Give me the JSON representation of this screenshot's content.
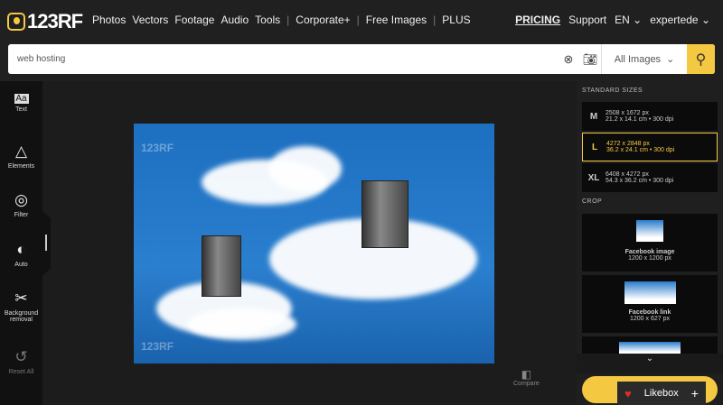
{
  "header": {
    "logo": "123RF",
    "nav": [
      "Photos",
      "Vectors",
      "Footage",
      "Audio",
      "Tools",
      "Corporate+",
      "Free Images",
      "PLUS"
    ],
    "pricing": "PRICING",
    "support": "Support",
    "lang": "EN",
    "user": "expertede"
  },
  "search": {
    "value": "web hosting",
    "filter": "All Images"
  },
  "tools": [
    {
      "label": "Text",
      "icon": "Aa"
    },
    {
      "label": "Elements",
      "icon": "shapes"
    },
    {
      "label": "Filter",
      "icon": "filter"
    },
    {
      "label": "Auto",
      "icon": "auto"
    },
    {
      "label": "Background removal",
      "icon": "scissors"
    },
    {
      "label": "Reset All",
      "icon": "undo"
    }
  ],
  "image": {
    "watermark": "123RF"
  },
  "compare": "Compare",
  "panel": {
    "standard_title": "STANDARD SIZES",
    "sizes": [
      {
        "code": "M",
        "px": "2508 x 1672 px",
        "cm": "21.2 x 14.1 cm • 300 dpi"
      },
      {
        "code": "L",
        "px": "4272 x 2848 px",
        "cm": "36.2 x 24.1 cm • 300 dpi"
      },
      {
        "code": "XL",
        "px": "6408 x 4272 px",
        "cm": "54.3 x 36.2 cm • 300 dpi"
      }
    ],
    "crop_title": "CROP",
    "crops": [
      {
        "name": "Facebook image",
        "size": "1200 x 1200 px"
      },
      {
        "name": "Facebook link",
        "size": "1200 x 627 px"
      }
    ]
  },
  "likebox": "Likebox",
  "colors": {
    "accent": "#f5c842"
  }
}
